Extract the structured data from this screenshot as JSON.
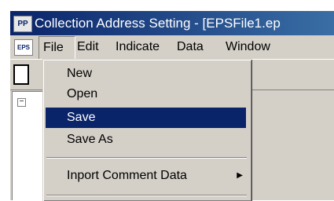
{
  "window": {
    "title": "Collection Address Setting - [EPSFile1.ep",
    "app_icon": "app-icon",
    "doc_icon_text": "EPS"
  },
  "menubar": {
    "items": [
      "File",
      "Edit",
      "Indicate",
      "Data",
      "Window"
    ]
  },
  "file_menu": {
    "items": [
      "New",
      "Open",
      "Save",
      "Save As",
      "Inport Comment Data"
    ],
    "highlighted": "Save",
    "submenu_arrow": "▶"
  },
  "tree": {
    "expander": "−"
  },
  "colors": {
    "highlight": "#0a246a",
    "chrome": "#d4d0c8"
  }
}
